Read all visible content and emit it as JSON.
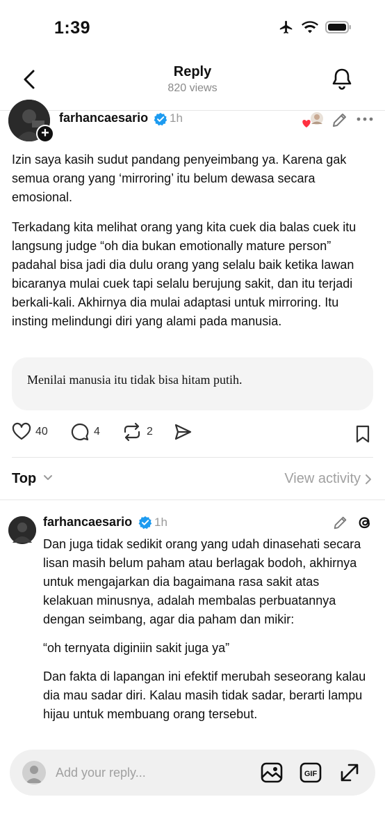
{
  "status_bar": {
    "time": "1:39",
    "icons": [
      "airplane-icon",
      "wifi-icon",
      "battery-icon"
    ]
  },
  "nav": {
    "title": "Reply",
    "subtitle": "820 views"
  },
  "post": {
    "username": "farhancaesario",
    "time": "1h",
    "paragraphs": [
      "Izin saya kasih sudut pandang penyeimbang ya. Karena gak semua orang yang ‘mirroring’ itu belum dewasa secara emosional.",
      "Terkadang kita melihat orang yang kita cuek dia balas cuek itu langsung judge “oh dia bukan emotionally mature person” padahal bisa jadi dia dulu orang yang selalu baik ketika lawan bicaranya mulai cuek tapi selalu berujung sakit, dan itu terjadi berkali-kali. Akhirnya dia mulai adaptasi untuk mirroring. Itu insting melindungi diri yang alami pada manusia."
    ],
    "quote": "Menilai manusia itu tidak bisa hitam putih.",
    "likes": "40",
    "comments": "4",
    "reposts": "2"
  },
  "sort": {
    "label": "Top",
    "view_activity": "View activity"
  },
  "reply": {
    "username": "farhancaesario",
    "time": "1h",
    "paragraphs": [
      "Dan juga tidak sedikit orang yang udah dinasehati secara lisan masih belum paham atau berlagak bodoh, akhirnya untuk mengajarkan dia bagaimana rasa sakit atas kelakuan minusnya, adalah membalas perbuatannya dengan seimbang, agar dia paham dan mikir:",
      "“oh ternyata diginiin sakit juga ya”",
      "Dan fakta di lapangan ini efektif merubah seseorang kalau dia mau sadar diri. Kalau masih tidak sadar, berarti lampu hijau untuk membuang orang tersebut."
    ]
  },
  "composer": {
    "placeholder": "Add your reply..."
  },
  "colors": {
    "verified": "#1d9bf0",
    "heart": "#ff3040",
    "muted": "#9a9a9a"
  }
}
